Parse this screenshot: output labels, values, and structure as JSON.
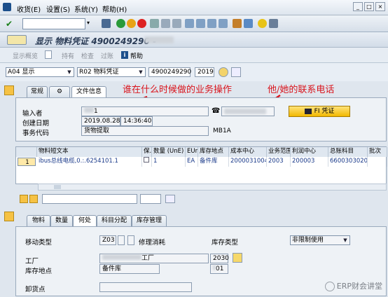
{
  "menu": {
    "items": [
      "收货(E)",
      "设置(S)",
      "系统(Y)",
      "帮助(H)"
    ]
  },
  "title": {
    "text": "显示 物料凭证 4900249290 - "
  },
  "app_toolbar": {
    "overview": "显示概览",
    "hold": "持有",
    "check": "检查",
    "filter": "过账",
    "help": "帮助"
  },
  "header": {
    "action": "A04 显示",
    "ref_doc": "R02 物料凭证",
    "doc_number": "4900249290",
    "year": "2019"
  },
  "tabs_top": [
    "常规",
    "文件信息"
  ],
  "annotations": {
    "when": "谁在什么时候做的业务操作",
    "phone": "他/她的联系电话"
  },
  "doc_info": {
    "entered_by_label": "输入者",
    "entered_by_value": "1",
    "created_label": "创建日期",
    "created_date": "2019.08.28",
    "created_time": "14:36:40",
    "txn_label": "事务代码",
    "txn_value": "货物提取",
    "txn_code": "MB1A",
    "fi_button": "FI 凭证"
  },
  "grid": {
    "columns": [
      "行",
      "物料短文本",
      "保.",
      "数量 (UnE)",
      "EUn",
      "库存地点",
      "成本中心",
      "业务范围",
      "利润中心",
      "总账科目",
      "批次"
    ],
    "row": {
      "line": "1",
      "text": "ibus总线电缆,0.:.6254101.1",
      "qty": "1",
      "eun": "EA",
      "sloc": "备件库",
      "cost_center": "2000031004",
      "bus_area": "2003",
      "profit_center": "200003",
      "gl": "6600303020",
      "batch": ""
    }
  },
  "tabs_bottom": [
    "物料",
    "数量",
    "何处",
    "科目分配",
    "库存管理"
  ],
  "detail": {
    "movement_label": "移动类型",
    "movement_code": "Z03",
    "movement_text": "修理消耗",
    "stock_type_label": "库存类型",
    "stock_type_value": "非限制使用",
    "plant_label": "工厂",
    "plant_text": "工厂",
    "plant_code": "2030",
    "sloc_label": "库存地点",
    "sloc_value": "备件库",
    "sloc_code": "01",
    "unload_label": "卸货点"
  },
  "watermark": "ERP财会讲堂"
}
